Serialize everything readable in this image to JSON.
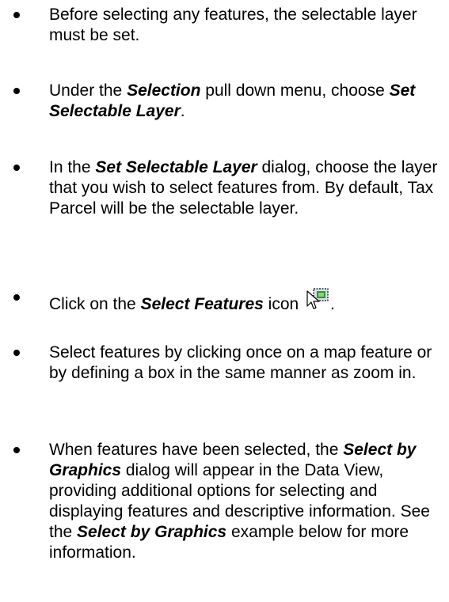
{
  "items": [
    {
      "bullet": "•",
      "segments": [
        {
          "text": "Before selecting any features, the selectable layer must be set.",
          "style": "normal"
        }
      ]
    },
    {
      "bullet": "•",
      "segments": [
        {
          "text": "Under the ",
          "style": "normal"
        },
        {
          "text": "Selection",
          "style": "bold-italic"
        },
        {
          "text": " pull down menu, choose ",
          "style": "normal"
        },
        {
          "text": "Set Selectable Layer",
          "style": "bold-italic"
        },
        {
          "text": ".",
          "style": "normal"
        }
      ]
    },
    {
      "bullet": "•",
      "segments": [
        {
          "text": "In the ",
          "style": "normal"
        },
        {
          "text": "Set Selectable Layer",
          "style": "bold-italic"
        },
        {
          "text": " dialog, choose the layer that you wish to select features from.  By default, Tax Parcel will be the selectable layer.",
          "style": "normal"
        }
      ]
    },
    {
      "bullet": "•",
      "segments": [
        {
          "text": "Click on the ",
          "style": "normal"
        },
        {
          "text": "Select Features",
          "style": "bold-italic"
        },
        {
          "text": " icon ",
          "style": "normal"
        }
      ],
      "icon": "select-features-icon",
      "after_icon": "."
    },
    {
      "bullet": "•",
      "segments": [
        {
          "text": "Select features by clicking once on a map feature or by defining a box in the same manner as zoom in.",
          "style": "normal"
        }
      ]
    },
    {
      "bullet": "•",
      "segments": [
        {
          "text": "When features have been selected, the ",
          "style": "normal"
        },
        {
          "text": "Select by Graphics",
          "style": "bold-italic"
        },
        {
          "text": " dialog will appear in the Data View, providing additional options for selecting and displaying features and descriptive information. See the ",
          "style": "normal"
        },
        {
          "text": "Select by Graphics",
          "style": "bold-italic"
        },
        {
          "text": " example below for more information.",
          "style": "normal"
        }
      ]
    }
  ]
}
